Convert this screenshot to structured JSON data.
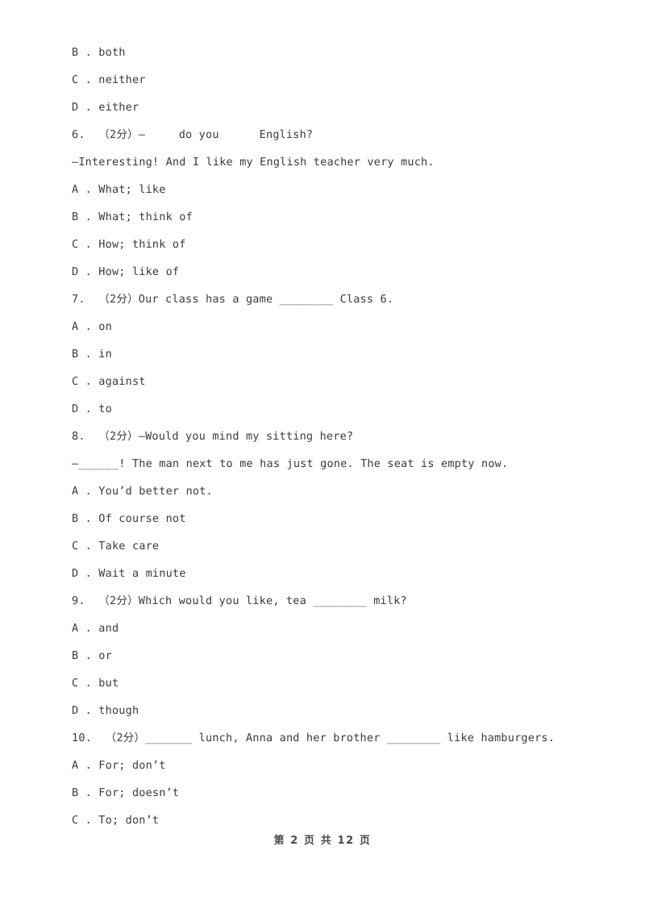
{
  "document": {
    "page_background": "#ffffff",
    "text_color": "#3b3b3b",
    "lines": [
      {
        "id": "l01",
        "kind": "option",
        "text": "B . both"
      },
      {
        "id": "l02",
        "kind": "option",
        "text": "C . neither"
      },
      {
        "id": "l03",
        "kind": "option",
        "text": "D . either"
      },
      {
        "id": "l04",
        "kind": "question",
        "text": "6.  （2分）—     do you      English?"
      },
      {
        "id": "l05",
        "kind": "question-cont",
        "text": "—Interesting! And I like my English teacher very much."
      },
      {
        "id": "l06",
        "kind": "option",
        "text": "A . What; like"
      },
      {
        "id": "l07",
        "kind": "option",
        "text": "B . What; think of"
      },
      {
        "id": "l08",
        "kind": "option",
        "text": "C . How; think of"
      },
      {
        "id": "l09",
        "kind": "option",
        "text": "D . How; like of"
      },
      {
        "id": "l10",
        "kind": "question",
        "text": "7.  （2分）Our class has a game ________ Class 6."
      },
      {
        "id": "l11",
        "kind": "option",
        "text": "A . on"
      },
      {
        "id": "l12",
        "kind": "option",
        "text": "B . in"
      },
      {
        "id": "l13",
        "kind": "option",
        "text": "C . against"
      },
      {
        "id": "l14",
        "kind": "option",
        "text": "D . to"
      },
      {
        "id": "l15",
        "kind": "question",
        "text": "8.  （2分）—Would you mind my sitting here?"
      },
      {
        "id": "l16",
        "kind": "question-cont",
        "text": "—______! The man next to me has just gone. The seat is empty now."
      },
      {
        "id": "l17",
        "kind": "option",
        "text": "A . You’d better not."
      },
      {
        "id": "l18",
        "kind": "option",
        "text": "B . Of course not"
      },
      {
        "id": "l19",
        "kind": "option",
        "text": "C . Take care"
      },
      {
        "id": "l20",
        "kind": "option",
        "text": "D . Wait a minute"
      },
      {
        "id": "l21",
        "kind": "question",
        "text": "9.  （2分）Which would you like, tea ________ milk?"
      },
      {
        "id": "l22",
        "kind": "option",
        "text": "A . and"
      },
      {
        "id": "l23",
        "kind": "option",
        "text": "B . or"
      },
      {
        "id": "l24",
        "kind": "option",
        "text": "C . but"
      },
      {
        "id": "l25",
        "kind": "option",
        "text": "D . though"
      },
      {
        "id": "l26",
        "kind": "question",
        "text": "10.  （2分）_______ lunch, Anna and her brother ________ like hamburgers."
      },
      {
        "id": "l27",
        "kind": "option",
        "text": "A . For; don’t"
      },
      {
        "id": "l28",
        "kind": "option",
        "text": "B . For; doesn’t"
      },
      {
        "id": "l29",
        "kind": "option",
        "text": "C . To; don’t"
      }
    ],
    "footer": {
      "text": "第 2 页 共 12 页",
      "current_page": "2",
      "total_pages": "12"
    }
  }
}
